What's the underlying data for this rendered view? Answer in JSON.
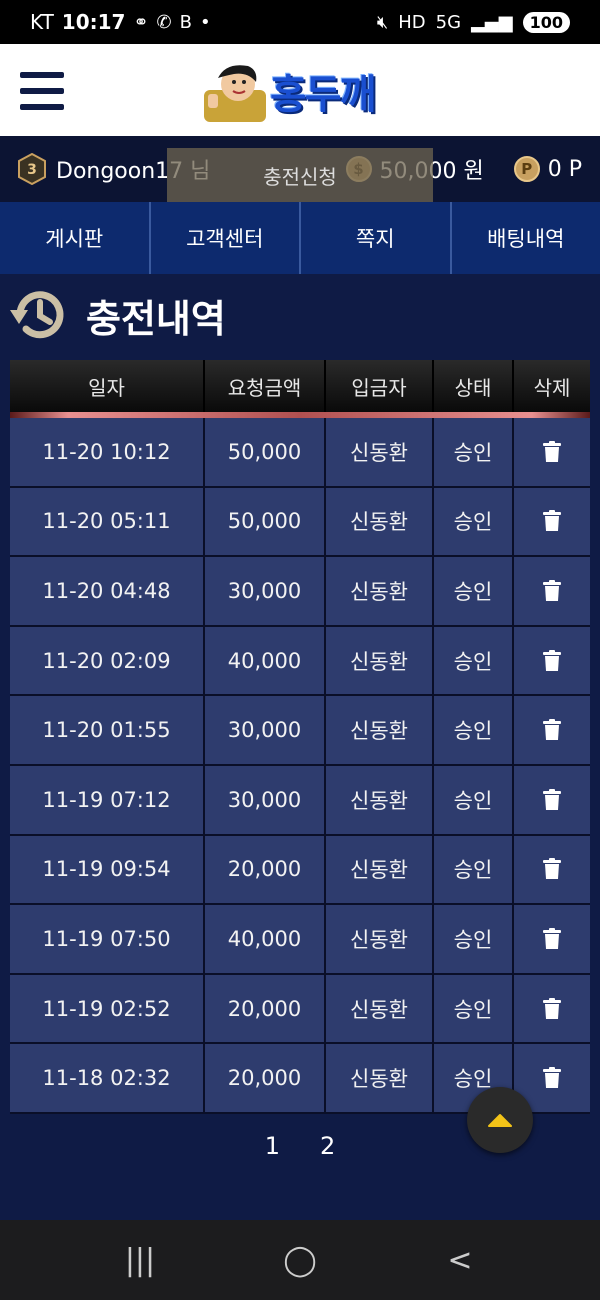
{
  "status_bar": {
    "carrier": "KT",
    "time": "10:17",
    "battery": "100"
  },
  "header": {
    "logo_text": "홍두깨"
  },
  "user": {
    "level": "3",
    "name": "Dongoon17 님",
    "money": "50,000 원",
    "points": "0 P",
    "coin_symbol": "$",
    "point_symbol": "P"
  },
  "charge_request": "충전신청",
  "nav": [
    "게시판",
    "고객센터",
    "쪽지",
    "배팅내역"
  ],
  "page_title": "충전내역",
  "table": {
    "headers": [
      "일자",
      "요청금액",
      "입금자",
      "상태",
      "삭제"
    ],
    "rows": [
      [
        "11-20 10:12",
        "50,000",
        "신동환",
        "승인"
      ],
      [
        "11-20 05:11",
        "50,000",
        "신동환",
        "승인"
      ],
      [
        "11-20 04:48",
        "30,000",
        "신동환",
        "승인"
      ],
      [
        "11-20 02:09",
        "40,000",
        "신동환",
        "승인"
      ],
      [
        "11-20 01:55",
        "30,000",
        "신동환",
        "승인"
      ],
      [
        "11-19 07:12",
        "30,000",
        "신동환",
        "승인"
      ],
      [
        "11-19 09:54",
        "20,000",
        "신동환",
        "승인"
      ],
      [
        "11-19 07:50",
        "40,000",
        "신동환",
        "승인"
      ],
      [
        "11-19 02:52",
        "20,000",
        "신동환",
        "승인"
      ],
      [
        "11-18 02:32",
        "20,000",
        "신동환",
        "승인"
      ]
    ]
  },
  "pagination": [
    "1",
    "2"
  ],
  "system_nav": {
    "recents": "|||",
    "home": "◯",
    "back": "<"
  },
  "colors": {
    "background": "#0f1b45",
    "nav": "#0d2a6e",
    "row": "#2e3c6e",
    "accent": "#f2c318"
  }
}
